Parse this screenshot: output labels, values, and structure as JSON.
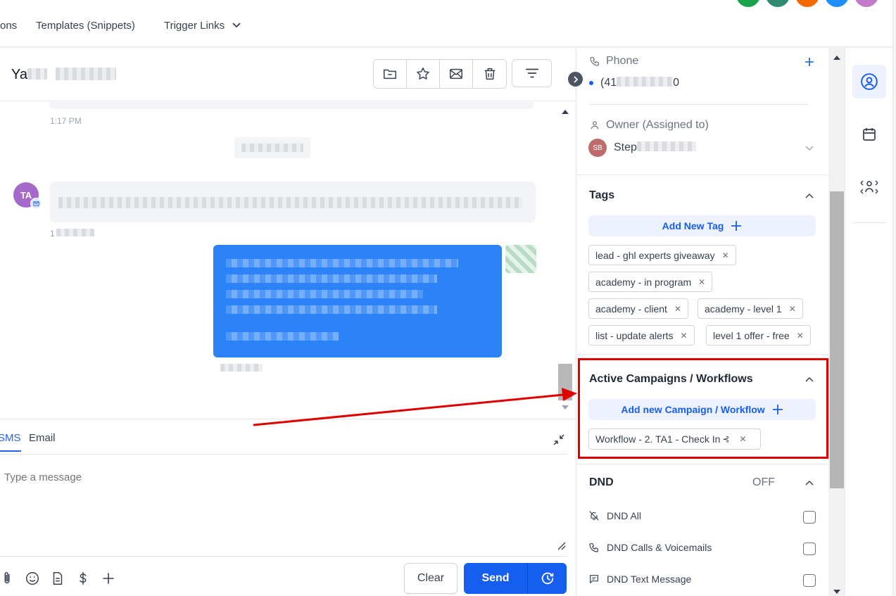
{
  "nav": {
    "items": [
      "ons",
      "Templates (Snippets)",
      "Trigger Links"
    ],
    "avatar_colors": [
      "#1aa34a",
      "#2e8b6f",
      "#f56a00",
      "#1f8efa",
      "#c27ac9"
    ]
  },
  "conversation": {
    "contact_name_prefix": "Ya",
    "times": [
      "1:17 PM",
      "1"
    ],
    "sender_initials": "TA"
  },
  "composer": {
    "tabs": [
      "SMS",
      "Email"
    ],
    "placeholder": "Type a message",
    "clear_label": "Clear",
    "send_label": "Send"
  },
  "panel": {
    "phone_label": "Phone",
    "phone_value_prefix": "(41",
    "phone_value_suffix": "0",
    "owner_label": "Owner (Assigned to)",
    "owner_initials": "SB",
    "owner_name_prefix": "Step",
    "tags_title": "Tags",
    "add_tag_label": "Add New Tag",
    "tags": [
      "lead - ghl experts giveaway",
      "academy - in program",
      "academy - client",
      "academy - level 1",
      "list - update alerts",
      "level 1 offer - free"
    ],
    "campaigns_title": "Active Campaigns / Workflows",
    "add_campaign_label": "Add new Campaign / Workflow",
    "workflows": [
      "Workflow - 2. TA1 - Check In"
    ],
    "dnd_title": "DND",
    "dnd_status": "OFF",
    "dnd_options": [
      "DND All",
      "DND Calls & Voicemails",
      "DND Text Message"
    ]
  },
  "colors": {
    "primary": "#155eef",
    "highlight": "#e00000",
    "sender_avatar": "#a56ac9",
    "owner_avatar": "#c06b6b"
  }
}
